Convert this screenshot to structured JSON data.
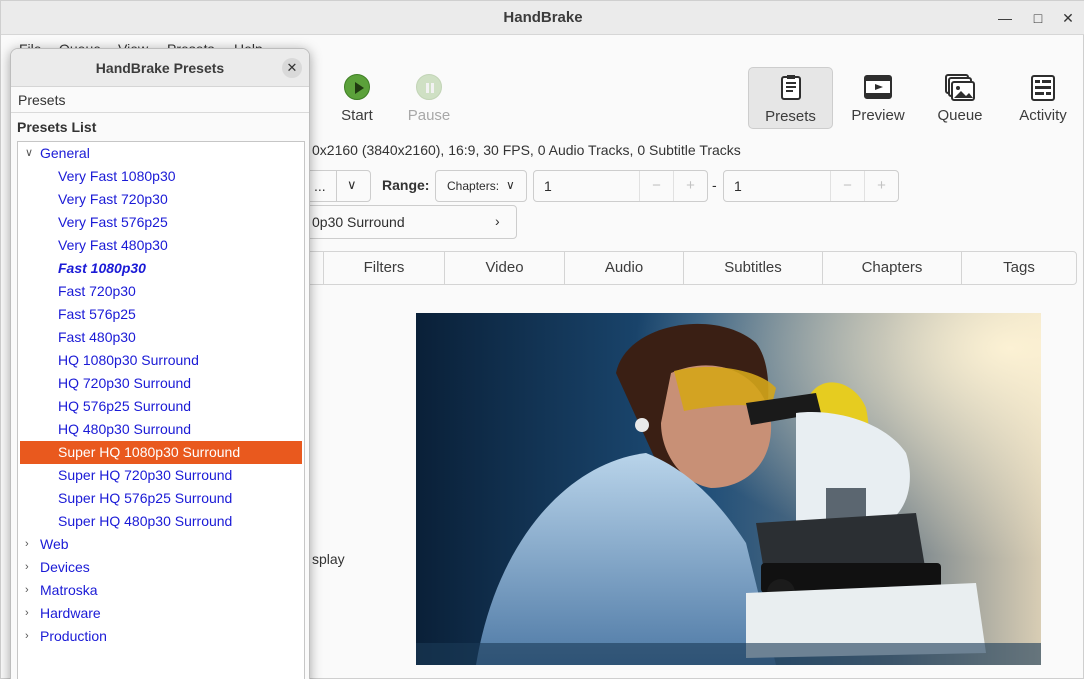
{
  "window": {
    "title": "HandBrake"
  },
  "menubar": [
    "File",
    "Queue",
    "View",
    "Presets",
    "Help"
  ],
  "toolbar": {
    "start": "Start",
    "pause": "Pause",
    "presets": "Presets",
    "preview": "Preview",
    "queue": "Queue",
    "activity": "Activity"
  },
  "source": {
    "info": "0x2160 (3840x2160), 16:9, 30 FPS, 0 Audio Tracks, 0 Subtitle Tracks"
  },
  "angle": {
    "value": "..."
  },
  "range": {
    "label": "Range:",
    "type": "Chapters:",
    "start": "1",
    "end": "1",
    "separator": "-"
  },
  "preset_selector": {
    "value": "0p30 Surround"
  },
  "tabs": [
    "Filters",
    "Video",
    "Audio",
    "Subtitles",
    "Chapters",
    "Tags"
  ],
  "summary": {
    "display_fragment": "splay"
  },
  "presets_dialog": {
    "title": "HandBrake Presets",
    "menu": "Presets",
    "list_heading": "Presets List",
    "general": {
      "label": "General",
      "items": [
        "Very Fast 1080p30",
        "Very Fast 720p30",
        "Very Fast 576p25",
        "Very Fast 480p30",
        "Fast 1080p30",
        "Fast 720p30",
        "Fast 576p25",
        "Fast 480p30",
        "HQ 1080p30 Surround",
        "HQ 720p30 Surround",
        "HQ 576p25 Surround",
        "HQ 480p30 Surround",
        "Super HQ 1080p30 Surround",
        "Super HQ 720p30 Surround",
        "Super HQ 576p25 Surround",
        "Super HQ 480p30 Surround"
      ],
      "default_item": "Fast 1080p30",
      "selected_item": "Super HQ 1080p30 Surround"
    },
    "categories": [
      "Web",
      "Devices",
      "Matroska",
      "Hardware",
      "Production"
    ]
  },
  "colors": {
    "accent": "#e9591e",
    "link": "#1a1ad6",
    "start_green": "#5ba13a"
  }
}
